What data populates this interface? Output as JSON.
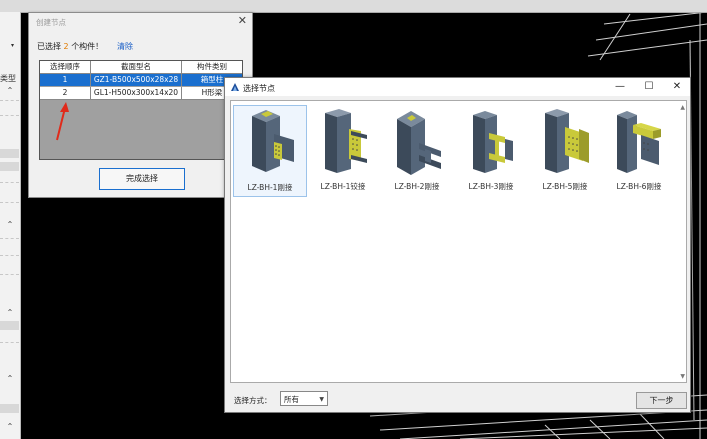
{
  "background": {
    "left_panel": {
      "label": "类型",
      "chevrons": [
        "⌃",
        "⌃",
        "⌃",
        "⌃",
        "⌃"
      ],
      "dropdown_icon": "▾"
    }
  },
  "create_node_dialog": {
    "title": "创建节点",
    "close_icon": "✕",
    "selected_prefix": "已选择",
    "selected_count": "2",
    "selected_suffix": "个构件！",
    "clear_label": "清除",
    "table": {
      "headers": [
        "选择顺序",
        "截面型名",
        "构件类别"
      ],
      "rows": [
        {
          "order": "1",
          "section": "GZ1-B500x500x28x28",
          "category": "箱型柱"
        },
        {
          "order": "2",
          "section": "GL1-H500x300x14x20",
          "category": "H形梁"
        }
      ]
    },
    "finish_button": "完成选择"
  },
  "select_node_dialog": {
    "title": "选择节点",
    "window_buttons": {
      "minimize": "—",
      "maximize": "☐",
      "close": "✕"
    },
    "tiles": [
      {
        "caption": "LZ-BH-1刚接",
        "selected": true
      },
      {
        "caption": "LZ-BH-1铰接",
        "selected": false
      },
      {
        "caption": "LZ-BH-2刚接",
        "selected": false
      },
      {
        "caption": "LZ-BH-3刚接",
        "selected": false
      },
      {
        "caption": "LZ-BH-5刚接",
        "selected": false
      },
      {
        "caption": "LZ-BH-6刚接",
        "selected": false
      }
    ],
    "method_label": "选择方式：",
    "method_value": "所有",
    "next_button": "下一步"
  },
  "colors": {
    "selection_blue": "#1a6fcf",
    "link_blue": "#1a5fc7",
    "count_orange": "#e07b00",
    "steel_gray": "#4b5b6e",
    "plate_yellow": "#c9c93a",
    "arrow_red": "#e02a1a"
  }
}
